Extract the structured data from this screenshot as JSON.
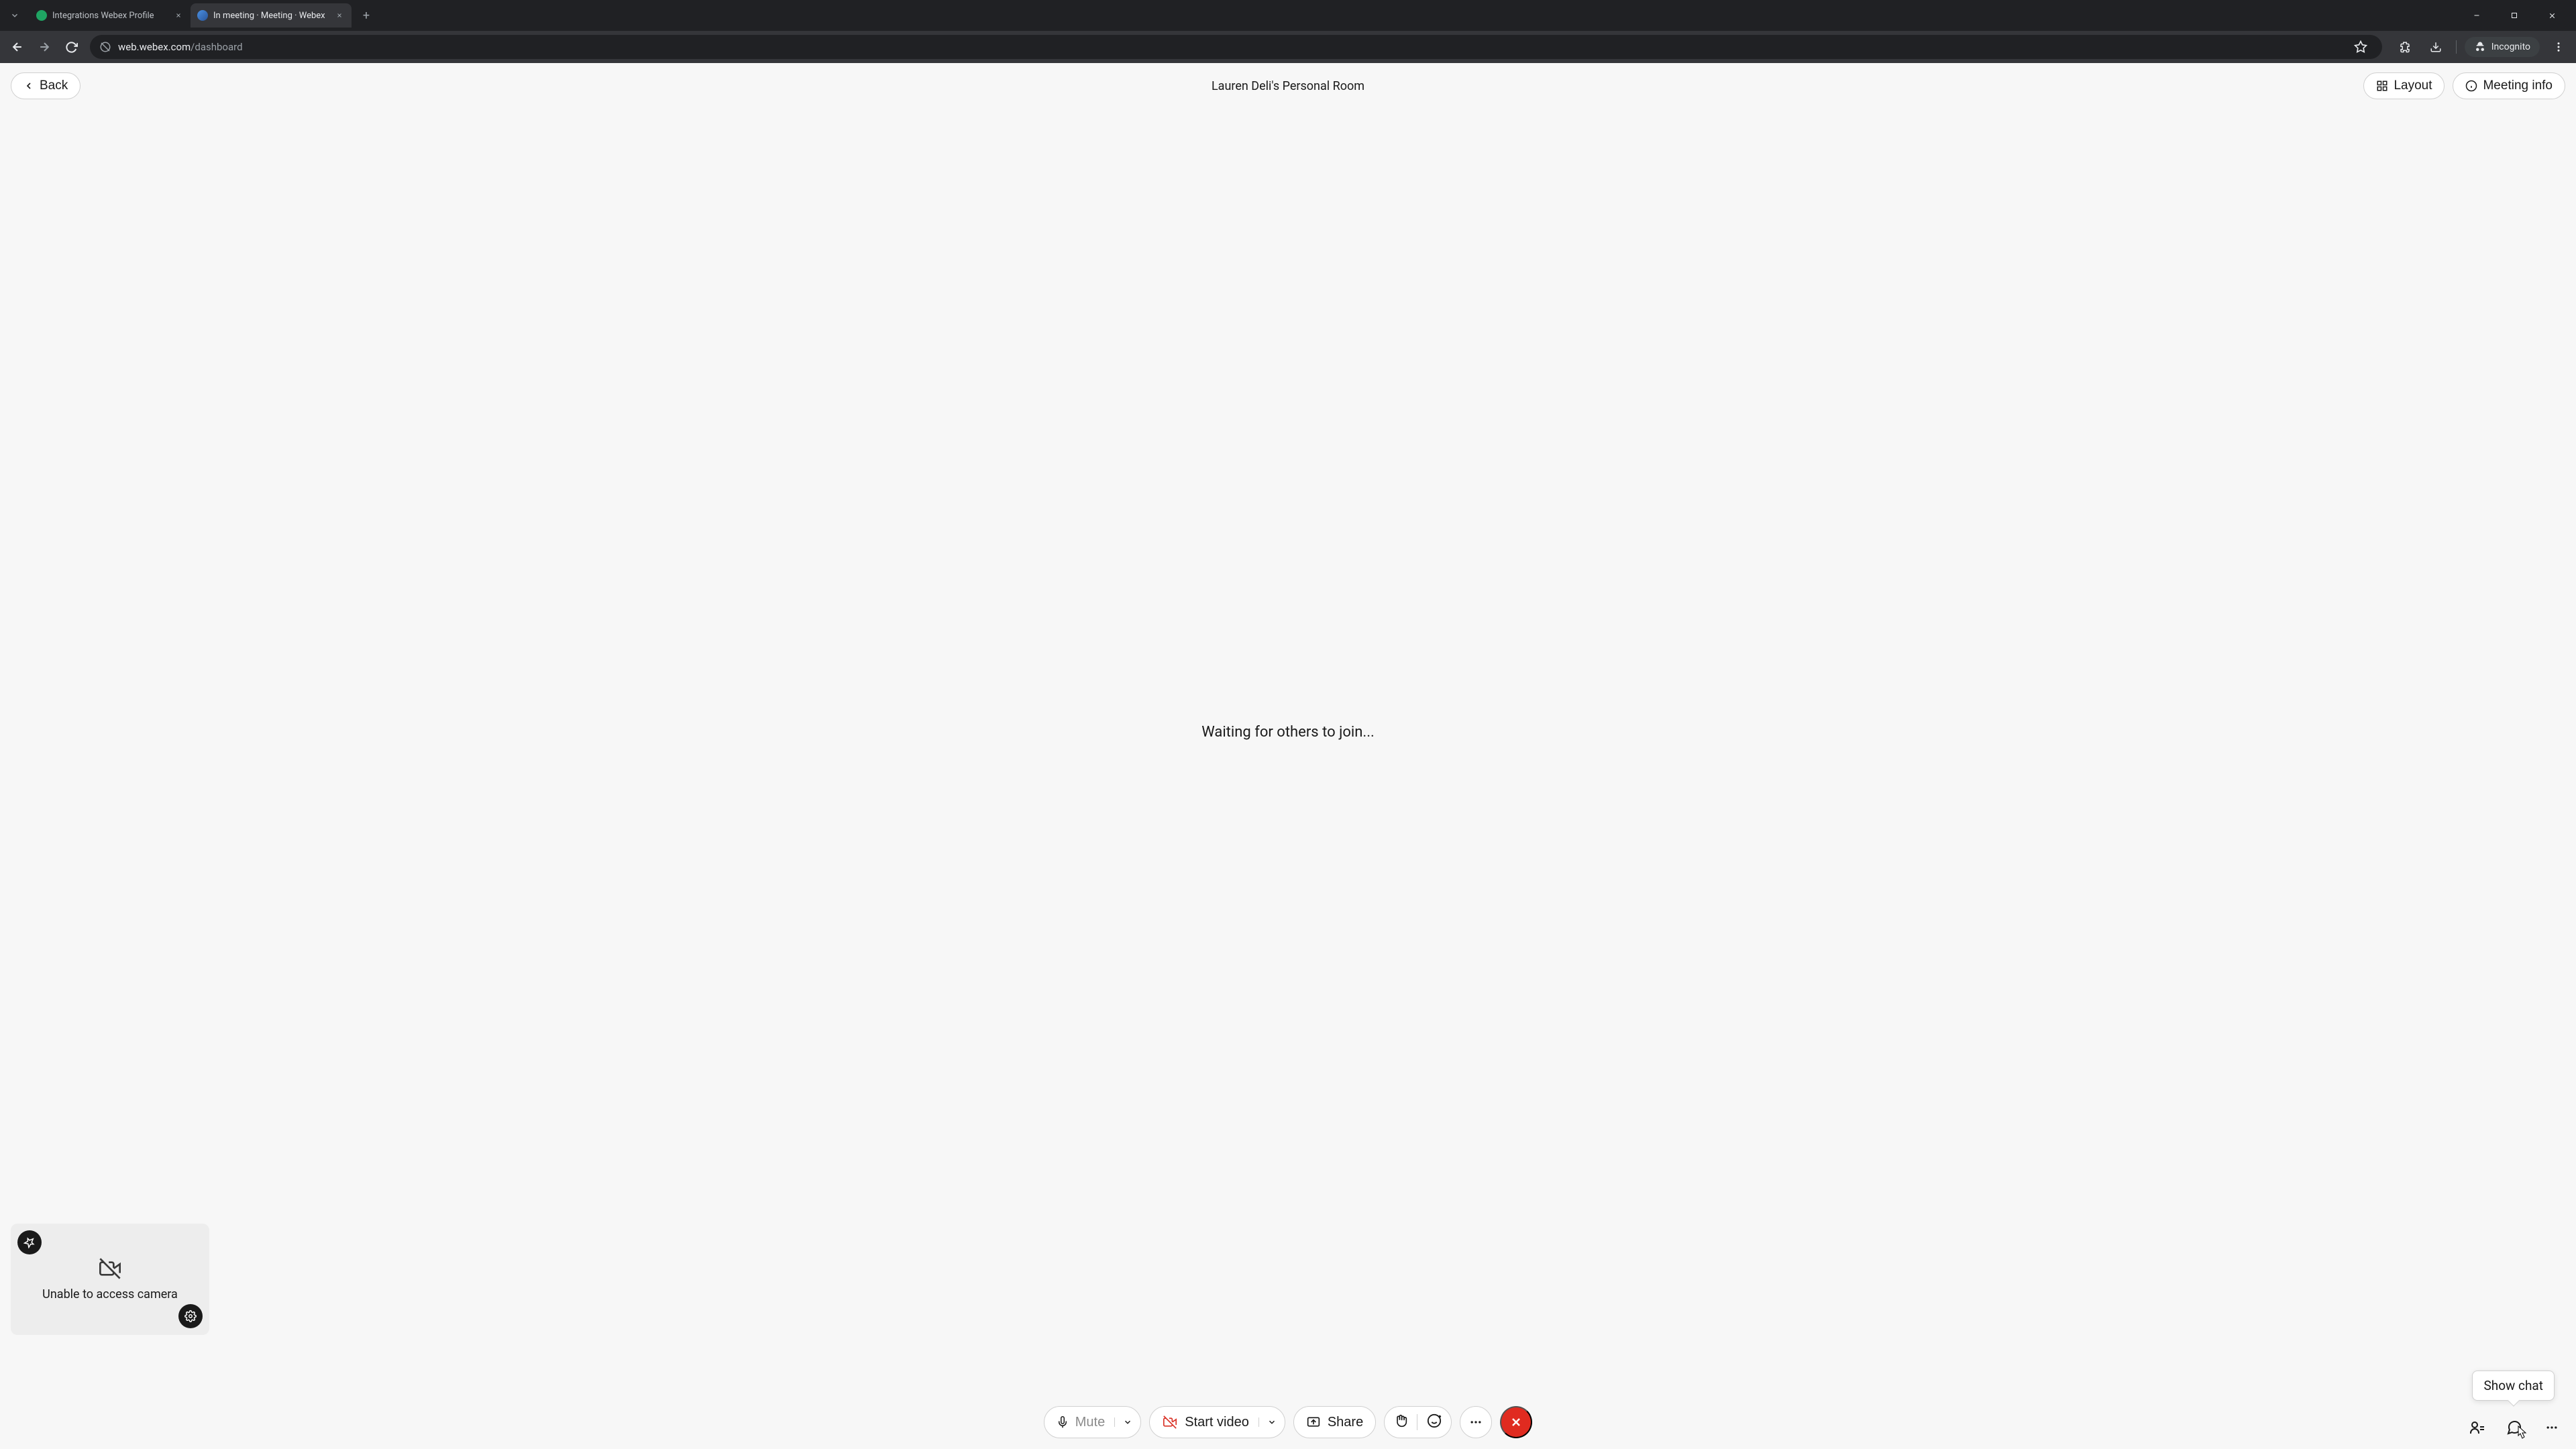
{
  "browser": {
    "tabs": [
      {
        "title": "Integrations Webex Profile",
        "active": false
      },
      {
        "title": "In meeting · Meeting · Webex",
        "active": true
      }
    ],
    "url_host": "web.webex.com",
    "url_path": "/dashboard",
    "incognito_label": "Incognito"
  },
  "topbar": {
    "back_label": "Back",
    "room_title": "Lauren Deli's Personal Room",
    "layout_label": "Layout",
    "meeting_info_label": "Meeting info"
  },
  "main": {
    "waiting_text": "Waiting for others to join..."
  },
  "self_view": {
    "camera_msg": "Unable to access camera"
  },
  "controls": {
    "mute_label": "Mute",
    "start_video_label": "Start video",
    "share_label": "Share"
  },
  "tooltip": {
    "show_chat": "Show chat"
  }
}
